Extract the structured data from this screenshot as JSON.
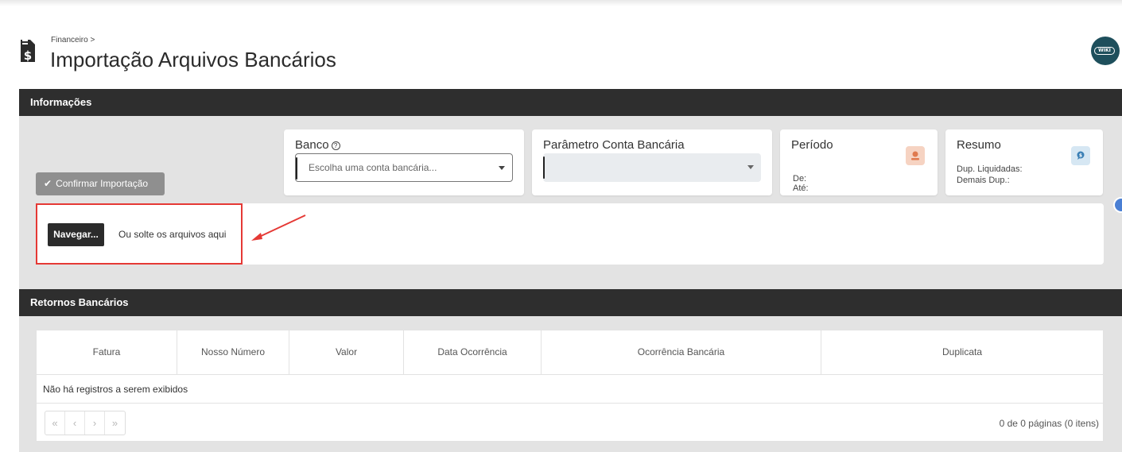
{
  "header": {
    "breadcrumb": "Financeiro >",
    "title": "Importação Arquivos Bancários",
    "doc_icon": "dollar-document-icon",
    "wiki_label": "WIKI",
    "wiki_color": "#1e4f5c"
  },
  "informacoes": {
    "section_title": "Informações",
    "confirm_button": "Confirmar Importação",
    "banco": {
      "label": "Banco",
      "placeholder": "Escolha uma conta bancária..."
    },
    "parametro": {
      "label": "Parâmetro Conta Bancária",
      "value": ""
    },
    "periodo": {
      "label": "Período",
      "de_label": "De:",
      "ate_label": "Até:",
      "icon": "user-badge-icon",
      "icon_color": "#f6d3c2"
    },
    "resumo": {
      "label": "Resumo",
      "liquidadas_label": "Dup. Liquidadas:",
      "demais_label": "Demais Dup.:",
      "icon": "chat-dollar-icon",
      "icon_color": "#d6e7f3"
    },
    "upload": {
      "browse_button": "Navegar...",
      "drop_text": "Ou solte os arquivos aqui"
    }
  },
  "retornos": {
    "section_title": "Retornos Bancários",
    "columns": [
      "Fatura",
      "Nosso Número",
      "Valor",
      "Data Ocorrência",
      "Ocorrência Bancária",
      "Duplicata"
    ],
    "empty_message": "Não há registros a serem exibidos",
    "pager": {
      "first": "«",
      "prev": "‹",
      "next": "›",
      "last": "»",
      "info": "0 de 0 páginas (0 itens)"
    }
  },
  "colors": {
    "section_bar": "#2e2e2e",
    "area_bg": "#e3e3e3",
    "highlight": "#e53935"
  }
}
